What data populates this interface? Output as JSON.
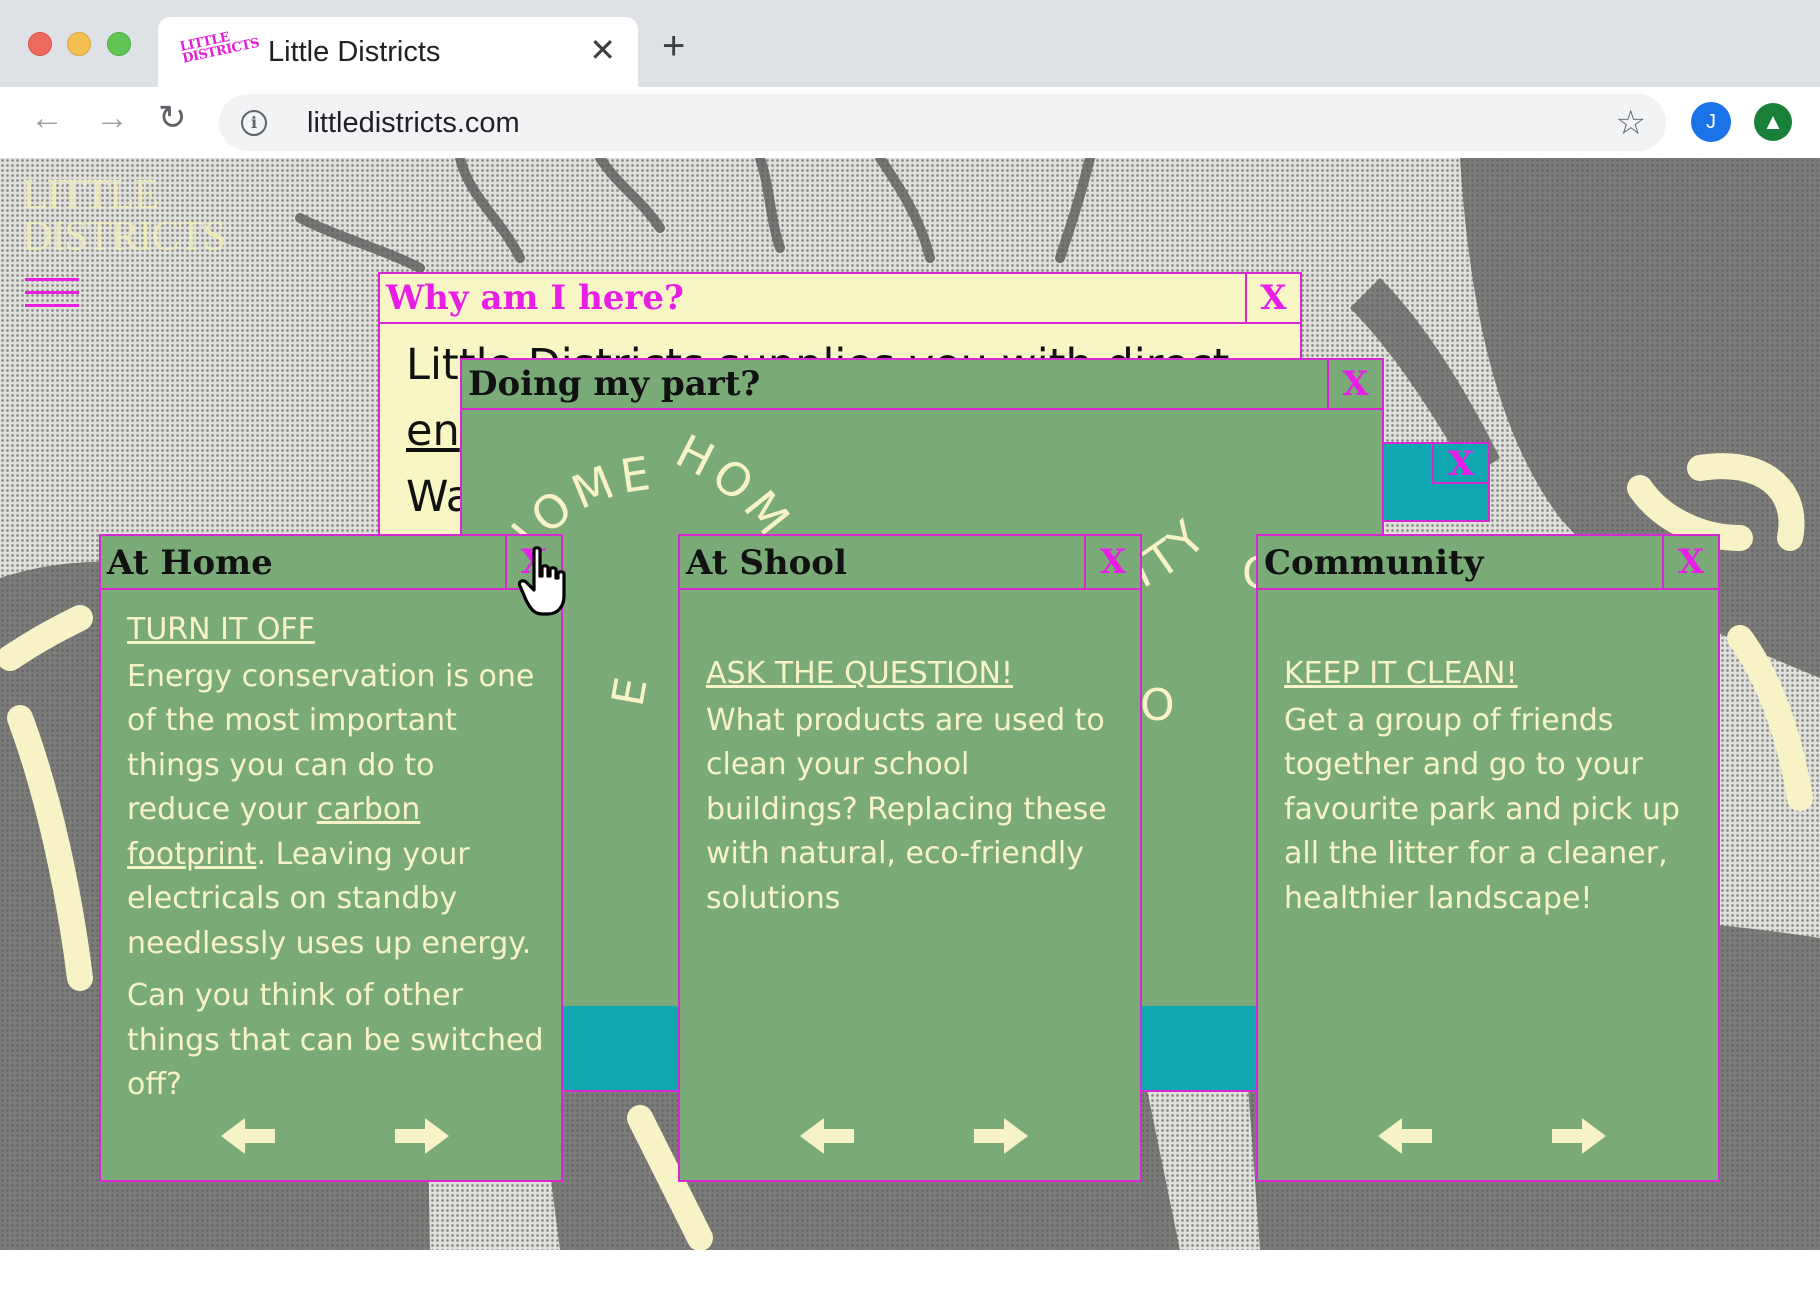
{
  "browser": {
    "tab_title": "Little Districts",
    "tab_favicon_text": "LITTLE DISTRICTS",
    "tab_close": "✕",
    "new_tab": "+",
    "url": "littledistricts.com",
    "avatar_letter": "J",
    "colors": {
      "tab_bar": "#dee1e6",
      "omnibox": "#f1f3f4",
      "avatar": "#1a73e8",
      "extension": "#188038"
    }
  },
  "site": {
    "logo_line1": "LITTLE",
    "logo_line2": "DISTRICTS",
    "colors": {
      "accent": "#e81ee6",
      "panel_green": "#7aaa78",
      "panel_cream": "#f9f6c6",
      "teal": "#0fa7b0",
      "text_cream": "#f7f3c6"
    }
  },
  "windows": {
    "why": {
      "title": "Why am I here?",
      "close": "X",
      "lines": [
        "Little Districts supplies you with direct",
        "en",
        "Wa"
      ]
    },
    "doing": {
      "title": "Doing my part?",
      "close": "X",
      "arc_words": [
        "HOME",
        "HOM",
        "ITY",
        "E",
        "C",
        "O"
      ]
    },
    "teal_close": "X"
  },
  "cards": [
    {
      "title": "At Home",
      "close": "X",
      "heading": "TURN IT OFF",
      "text_before": "Energy conservation is one of the most important things you can do to reduce your ",
      "link": "carbon footprint",
      "text_after": ". Leaving your electricals on standby needlessly uses up energy.",
      "more": "Can you think of other things that can be switched off?"
    },
    {
      "title": "At Shool",
      "close": "X",
      "heading": "ASK THE QUESTION!",
      "text": "What products are used to clean your school buildings? Replacing these with natural, eco-friendly solutions"
    },
    {
      "title": "Community",
      "close": "X",
      "heading": "KEEP IT CLEAN!",
      "text": "Get a group of friends together and go to your favourite park and pick up all the litter for a cleaner, healthier landscape!"
    }
  ]
}
